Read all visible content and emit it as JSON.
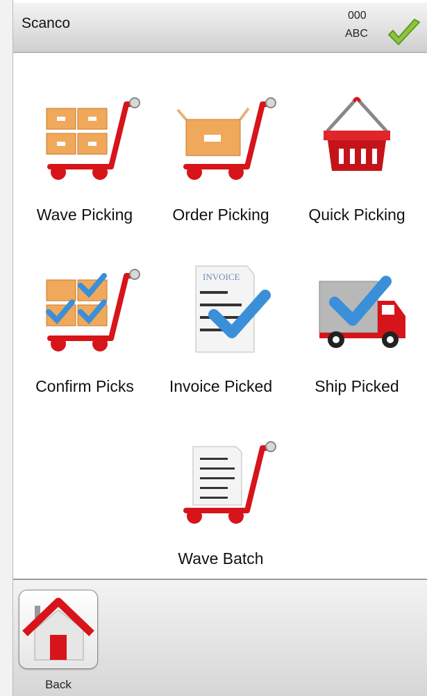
{
  "header": {
    "title": "Scanco",
    "code": "000",
    "subcode": "ABC",
    "status_icon": "check-icon"
  },
  "menu": [
    {
      "id": "wave-picking",
      "label": "Wave Picking",
      "icon": "cart-boxes-icon"
    },
    {
      "id": "order-picking",
      "label": "Order Picking",
      "icon": "cart-box-icon"
    },
    {
      "id": "quick-picking",
      "label": "Quick Picking",
      "icon": "basket-icon"
    },
    {
      "id": "confirm-picks",
      "label": "Confirm Picks",
      "icon": "cart-check-icon"
    },
    {
      "id": "invoice-picked",
      "label": "Invoice Picked",
      "icon": "invoice-check-icon",
      "invoice_text": "INVOICE"
    },
    {
      "id": "ship-picked",
      "label": "Ship Picked",
      "icon": "truck-check-icon"
    },
    {
      "id": "wave-batch",
      "label": "Wave Batch",
      "icon": "cart-document-icon"
    }
  ],
  "footer": {
    "back_label": "Back",
    "back_icon": "home-icon"
  },
  "colors": {
    "accent_red": "#d7141a",
    "check_blue": "#3b8fd8",
    "header_check_green": "#8cc63f"
  }
}
